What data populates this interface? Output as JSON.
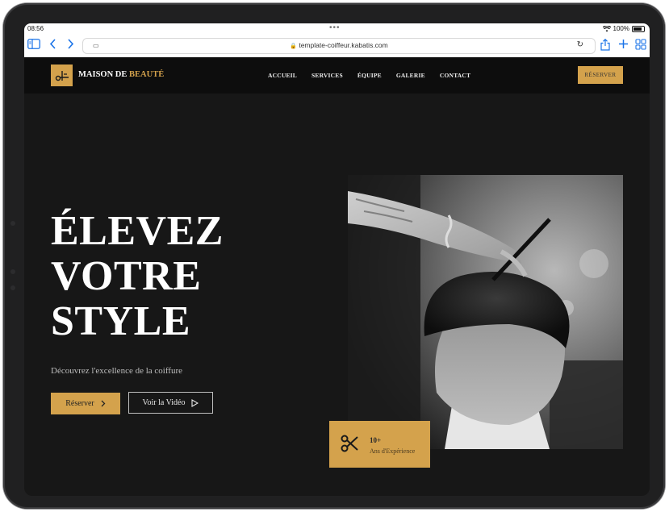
{
  "status_bar": {
    "time": "08:56",
    "dots": "•••",
    "battery": "100%"
  },
  "browser": {
    "url": "template-coiffeur.kabatis.com"
  },
  "site": {
    "brand_main": "MAISON DE",
    "brand_accent": "BEAUTÉ",
    "nav": [
      "ACCUEIL",
      "SERVICES",
      "ÉQUIPE",
      "GALERIE",
      "CONTACT"
    ],
    "reserve_top": "RÉSERVER"
  },
  "hero": {
    "title_lines": [
      "ÉLEVEZ",
      "VOTRE",
      "STYLE"
    ],
    "subtitle": "Découvrez l'excellence de la coiffure",
    "btn_primary": "Réserver",
    "btn_secondary": "Voir la Vidéo"
  },
  "badge": {
    "number": "10+",
    "label": "Ans d'Expérience"
  },
  "colors": {
    "accent": "#d4a24c",
    "background": "#171717",
    "header": "#0d0d0d"
  }
}
